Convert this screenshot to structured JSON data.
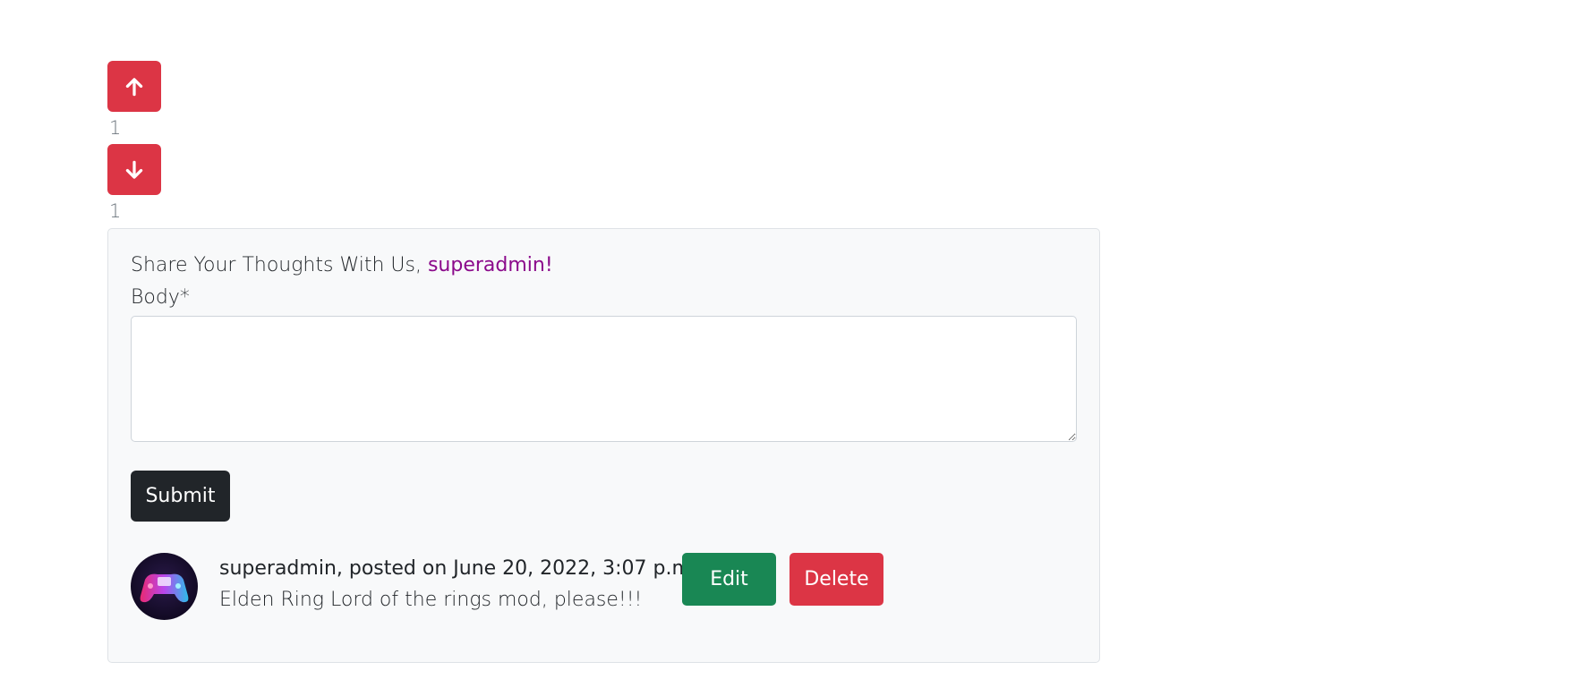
{
  "votes": {
    "upvote_icon": "arrow-up-icon",
    "upvote_count": "1",
    "downvote_icon": "arrow-down-icon",
    "downvote_count": "1",
    "button_color": "#dc3545"
  },
  "comment_form": {
    "greeting": "Share Your Thoughts With Us, ",
    "username": "superadmin!",
    "username_color": "#8b0a8b",
    "body_label": "Body*",
    "body_value": "",
    "submit_label": "Submit"
  },
  "comments": [
    {
      "avatar_icon": "gamepad-neon-icon",
      "meta": "superadmin, posted on June 20, 2022, 3:07 p.m.",
      "body": "Elden Ring Lord of the rings mod, please!!!",
      "edit_label": "Edit",
      "delete_label": "Delete"
    }
  ]
}
